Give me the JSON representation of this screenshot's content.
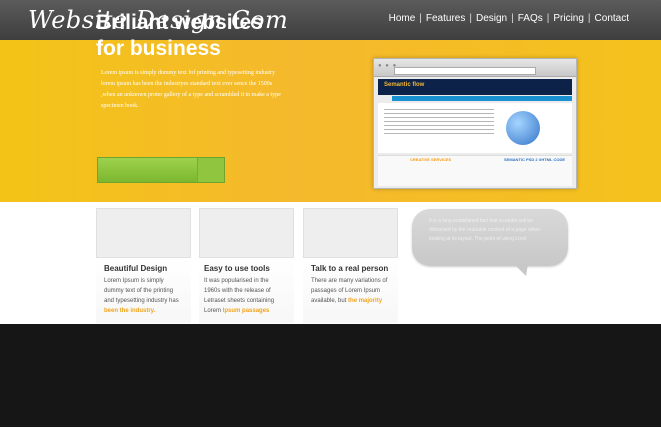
{
  "brand": {
    "logo_text": "Website Design Com"
  },
  "nav": {
    "items": [
      {
        "label": "Home"
      },
      {
        "label": "Features"
      },
      {
        "label": "Design"
      },
      {
        "label": "FAQs"
      },
      {
        "label": "Pricing"
      },
      {
        "label": "Contact"
      }
    ],
    "separator": "|"
  },
  "hero": {
    "title_line1": "Briliant websites",
    "title_line2": "for business",
    "body": "Lorem ipsum is simply dummy text fof printing and typesetting industry lorem ipsum has been the industryes standard text ever sence the 1500s ,when an unknown proter gallery of a type and scrambled it to make a type specimen book."
  },
  "screenshot": {
    "site_name": "Semantic flow",
    "section_one": "CREATIVE SERVICES",
    "section_two": "SEMANTIC PSD 2 XHTML CODE"
  },
  "features": [
    {
      "title": "Beautiful Design",
      "text": "Lorem Ipsum is simply dummy text of the printing and typesetting industry has",
      "highlight": "been the industry."
    },
    {
      "title": "Easy to use tools",
      "text": "It was popularised in the 1960s with the release of Letraset sheets containing Lorem",
      "highlight": "Ipsum passages"
    },
    {
      "title": "Talk to a real person",
      "text": "There are many variations of passages of Lorem Ipsum available, but",
      "highlight": "the majority"
    }
  ],
  "quote": {
    "text": "It is a long established fact that a reader will be distracted by the readable content of a page when looking at its layout. The point of using Lorel"
  },
  "colors": {
    "topbar": "#4b4b4b",
    "hero": "#f3c417",
    "accent": "#f0a41d",
    "button": "#8ec63f",
    "footer": "#161616"
  }
}
